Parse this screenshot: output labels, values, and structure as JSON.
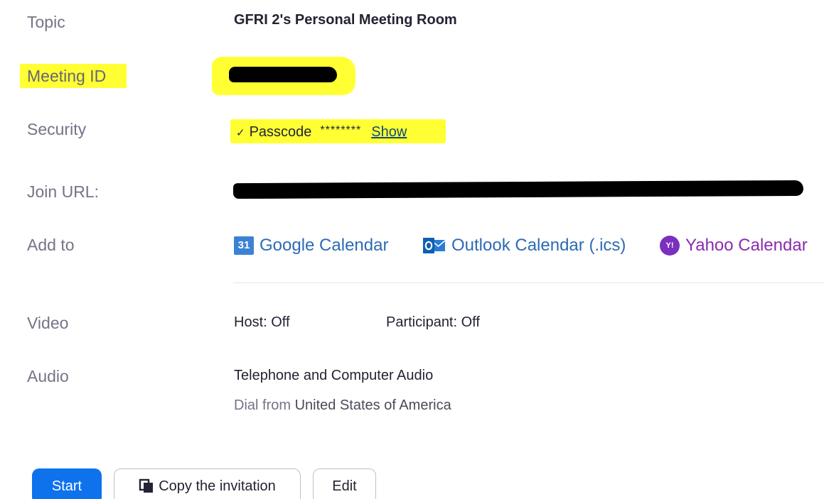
{
  "topic": {
    "label": "Topic",
    "value": "GFRI 2's Personal Meeting Room"
  },
  "meeting_id": {
    "label": "Meeting ID"
  },
  "security": {
    "label": "Security",
    "check": "✓",
    "passcode_label": "Passcode",
    "passcode_masked": "********",
    "show_link": "Show"
  },
  "join_url": {
    "label": "Join URL:"
  },
  "add_to": {
    "label": "Add to",
    "google": {
      "icon_text": "31",
      "label": "Google Calendar"
    },
    "outlook": {
      "label": "Outlook Calendar (.ics)"
    },
    "yahoo": {
      "icon_text": "Y!",
      "label": "Yahoo Calendar"
    }
  },
  "video": {
    "label": "Video",
    "host": "Host: Off",
    "participant": "Participant: Off"
  },
  "audio": {
    "label": "Audio",
    "value": "Telephone and Computer Audio",
    "dial_prefix": "Dial from",
    "dial_country": "United States of America"
  },
  "buttons": {
    "start": "Start",
    "copy": "Copy the invitation",
    "edit": "Edit"
  },
  "colors": {
    "highlight": "#ffff33",
    "primary_button": "#0e72ed",
    "link": "#2d6bb4",
    "yahoo": "#7b2fbe",
    "label_gray": "#747487"
  }
}
